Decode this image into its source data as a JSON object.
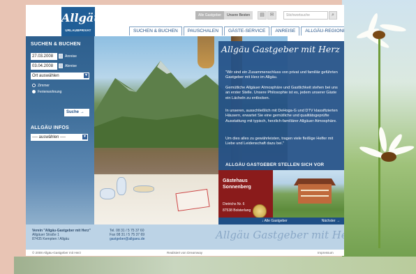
{
  "logo": {
    "word": "Allgäu",
    "sub": "URLAUBPRIVAT"
  },
  "header": {
    "toggle_all": "Alle Gastgeber",
    "toggle_best": "Unsere Besten",
    "search_placeholder": "Stichwortsuche",
    "print_icon": "print-icon",
    "mail_icon": "mail-icon"
  },
  "nav": [
    "SUCHEN & BUCHEN",
    "PAUSCHALEN",
    "GÄSTE-SERVICE",
    "ANREISE",
    "ALLGÄU-REGIONEN"
  ],
  "sidebar": {
    "search_title": "SUCHEN & BUCHEN",
    "arrival_date": "27.03.2008",
    "arrival_label": "Anreise",
    "departure_date": "03.04.2008",
    "departure_label": "Abreise",
    "place_select": "Ort auswählen",
    "radio_rooms": "Zimmer",
    "radio_holiday": "Ferienwohnung",
    "search_button": "Suche",
    "info_title": "ALLGÄU INFOS",
    "info_select": "---- auswählen ----"
  },
  "panel": {
    "title": "Allgäu Gastgeber mit Herz",
    "p1": "\"Wir sind ein Zusammenschluss von privat und familiär geführten Gastgeber mit Herz im Allgäu.",
    "p2": "Gemütliche Allgäuer Atmosphäre und Gastlichkeit stehen bei uns an erster Stelle. Unsere Philosophie ist es, jedem unserer Gäste ein Lächeln zu entlocken.",
    "p3": "In unseren, ausschließlich mit DeHoga-G und DTV klassifizierten Häusern, erwartet Sie eine gemütliche und qualitätsgeprüfte Ausstattung mit typisch, herzlich-familiärer Allgäuer Atmosphäre.",
    "p4": "Um dies alles zu gewährleisten, tragen viele fleißige Helfer mit Liebe und Leidenschaft dazu bei.\"",
    "subtitle": "ALLGÄU GASTGEBER STELLEN SICH VOR",
    "promo_name": "Gästehaus Sonnenberg",
    "promo_stars": "Dietrichs Nr. 6",
    "promo_addr": "87538 Bolsterlang",
    "pager_all": "Alle Gastgeber",
    "pager_next": "Nächster"
  },
  "footer": {
    "org_name": "Verein \"Allgäu-Gastgeber mit Herz\"",
    "street": "Allgäuer Straße 1",
    "city": "87435 Kempten / Allgäu",
    "tel": "Tel. 08 31 / 5 75 37 60",
    "fax": "Fax 08 31 / 5 75 37 69",
    "email": "gastgeber@allgaeu.de",
    "script": "Allgäu Gastgeber mit Herz",
    "copyright": "© 2008 Allgäu-Gastgeber mit Herz",
    "realised": "Realisiert von Dreamway",
    "impressum": "Impressum"
  }
}
